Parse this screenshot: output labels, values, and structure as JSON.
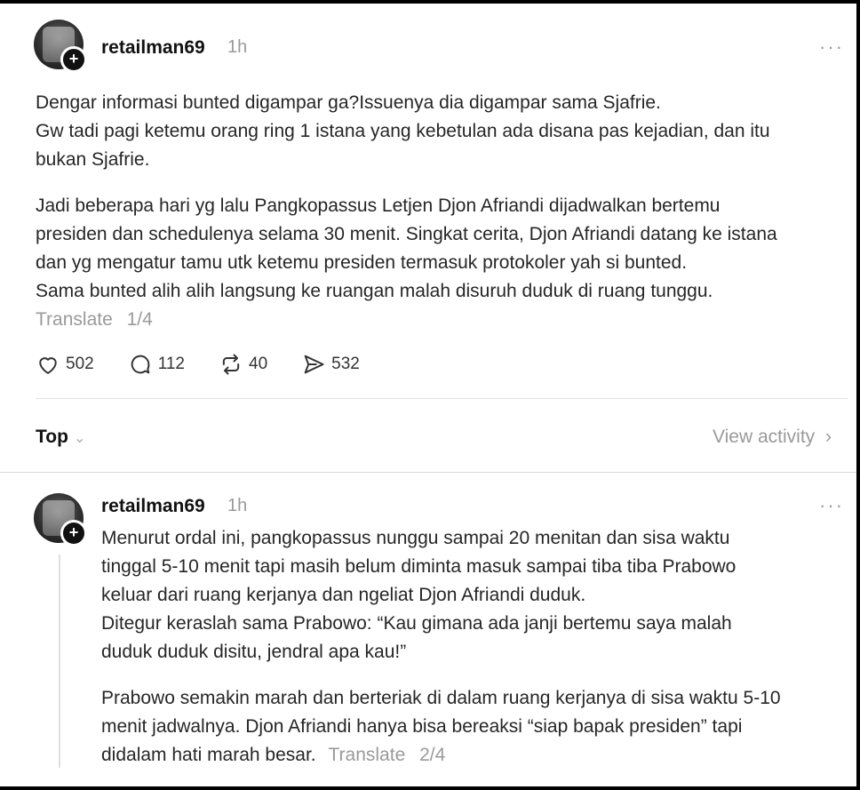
{
  "post": {
    "username": "retailman69",
    "time": "1h",
    "more": "···",
    "paragraphs": [
      [
        "Dengar informasi bunted digampar ga?Issuenya dia digampar sama Sjafrie.",
        "Gw tadi pagi ketemu orang ring 1 istana yang kebetulan ada disana pas kejadian, dan itu",
        "bukan Sjafrie."
      ],
      [
        "Jadi beberapa hari yg lalu Pangkopassus Letjen Djon Afriandi dijadwalkan bertemu",
        "presiden dan schedulenya selama 30 menit. Singkat cerita, Djon Afriandi datang ke istana",
        "dan yg mengatur tamu utk ketemu presiden termasuk protokoler yah si bunted.",
        "Sama bunted alih alih langsung ke ruangan malah disuruh duduk di ruang tunggu."
      ]
    ],
    "translate_label": "Translate",
    "counter": "1/4",
    "likes": "502",
    "comments": "112",
    "reposts": "40",
    "shares": "532"
  },
  "sort": {
    "label": "Top",
    "chevron": "⌄",
    "view_activity": "View activity",
    "view_chevron": "›"
  },
  "reply": {
    "username": "retailman69",
    "time": "1h",
    "more": "···",
    "paragraphs": [
      [
        "Menurut ordal ini, pangkopassus nunggu sampai 20 menitan dan sisa waktu",
        "tinggal 5-10 menit tapi masih belum diminta masuk sampai tiba tiba Prabowo",
        "keluar dari ruang kerjanya dan ngeliat Djon Afriandi duduk.",
        "Ditegur keraslah sama Prabowo: “Kau gimana ada janji bertemu saya malah",
        "duduk duduk disitu, jendral apa kau!”"
      ],
      [
        "Prabowo semakin marah dan berteriak di dalam ruang kerjanya di sisa waktu 5-10",
        "menit jadwalnya. Djon Afriandi hanya bisa bereaksi “siap bapak presiden” tapi",
        "didalam hati marah besar."
      ]
    ],
    "translate_label": "Translate",
    "counter": "2/4"
  },
  "icons": {
    "heart": "heart-icon",
    "comment": "comment-icon",
    "repost": "repost-icon",
    "share": "share-icon",
    "plus": "+"
  }
}
